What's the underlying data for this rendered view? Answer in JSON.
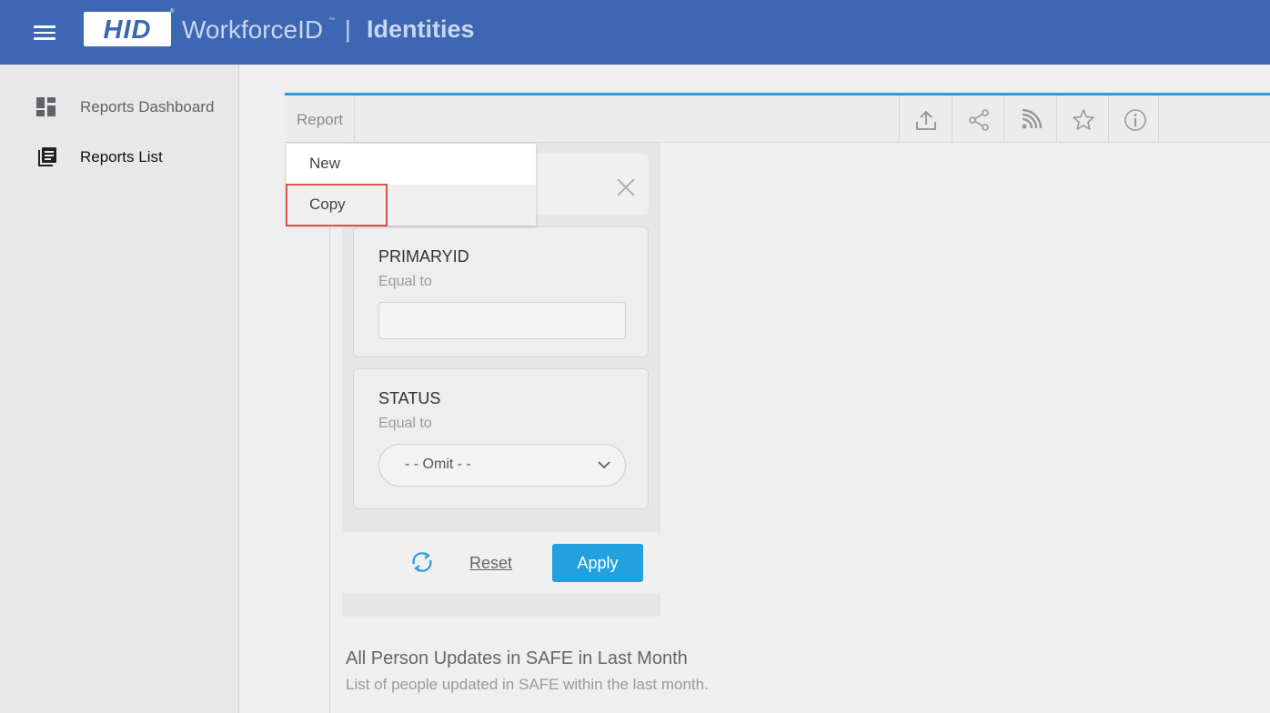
{
  "header": {
    "logo_text": "HID",
    "logo_reg": "®",
    "product": "WorkforceID",
    "product_tm": "™",
    "separator": "|",
    "section": "Identities",
    "bar_color": "#3d67b3"
  },
  "sidebar": {
    "items": [
      {
        "label": "Reports Dashboard",
        "icon": "dashboard-icon"
      },
      {
        "label": "Reports List",
        "icon": "reports-list-icon",
        "active": true
      }
    ]
  },
  "toolbar": {
    "report_label": "Report",
    "icons": [
      "export-icon",
      "share-icon",
      "rss-feed-icon",
      "star-icon",
      "info-icon"
    ]
  },
  "dropdown": {
    "items": [
      {
        "label": "New"
      },
      {
        "label": "Copy",
        "highlighted": true
      }
    ]
  },
  "filters": [
    {
      "title": "PRIMARYID",
      "operator": "Equal to",
      "value": ""
    },
    {
      "title": "STATUS",
      "operator": "Equal to",
      "selected": "- - Omit - -"
    }
  ],
  "filter_actions": {
    "reset_label": "Reset",
    "apply_label": "Apply",
    "apply_color": "#22a0e0"
  },
  "report": {
    "title": "All Person Updates in SAFE in Last Month",
    "description": "List of people updated in SAFE within the last month."
  }
}
